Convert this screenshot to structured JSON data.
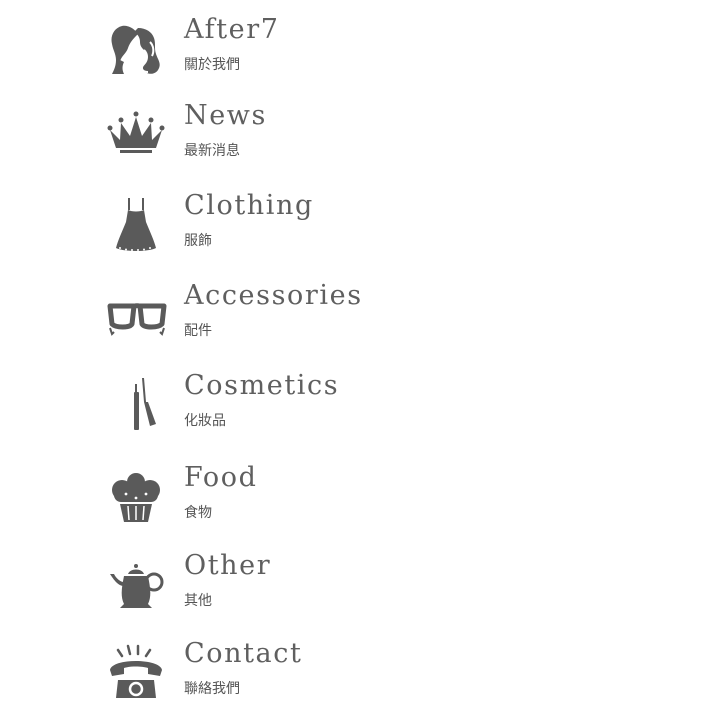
{
  "menu": {
    "items": [
      {
        "title": "After7",
        "subtitle": "關於我們",
        "icon": "lady-silhouette-icon"
      },
      {
        "title": "News",
        "subtitle": "最新消息",
        "icon": "crown-icon"
      },
      {
        "title": "Clothing",
        "subtitle": "服飾",
        "icon": "dress-icon"
      },
      {
        "title": "Accessories",
        "subtitle": "配件",
        "icon": "glasses-icon"
      },
      {
        "title": "Cosmetics",
        "subtitle": "化妝品",
        "icon": "mascara-icon"
      },
      {
        "title": "Food",
        "subtitle": "食物",
        "icon": "cupcake-icon"
      },
      {
        "title": "Other",
        "subtitle": "其他",
        "icon": "teapot-icon"
      },
      {
        "title": "Contact",
        "subtitle": "聯絡我們",
        "icon": "telephone-icon"
      }
    ]
  },
  "colors": {
    "icon": "#5a5a5a",
    "text": "#5f5f5f"
  }
}
